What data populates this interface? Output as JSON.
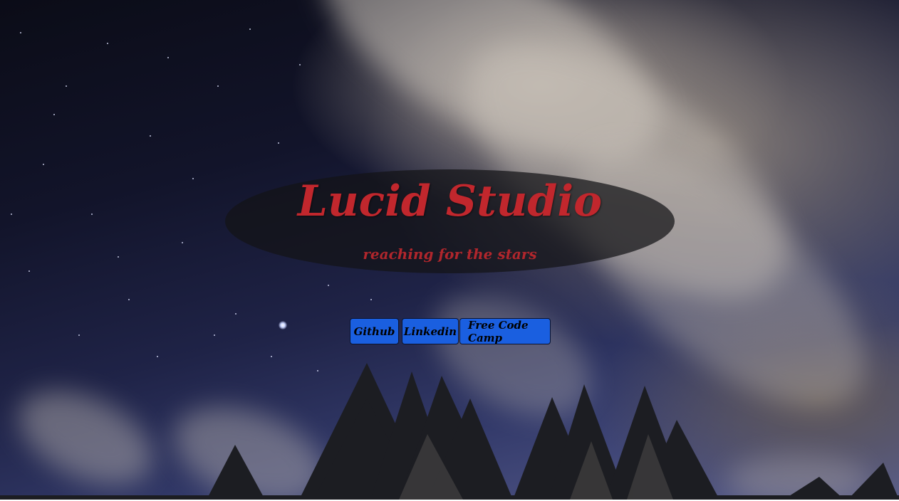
{
  "header": {
    "title": "Lucid Studio",
    "tagline": "reaching for the stars"
  },
  "links": [
    {
      "label": "Github"
    },
    {
      "label": "Linkedin"
    },
    {
      "label": "Free Code Camp"
    }
  ],
  "colors": {
    "title": "#c1272d",
    "button_background": "#1a5fe0",
    "oval": "#141416"
  },
  "background_image": "night-sky-with-clouds-and-pine-trees"
}
